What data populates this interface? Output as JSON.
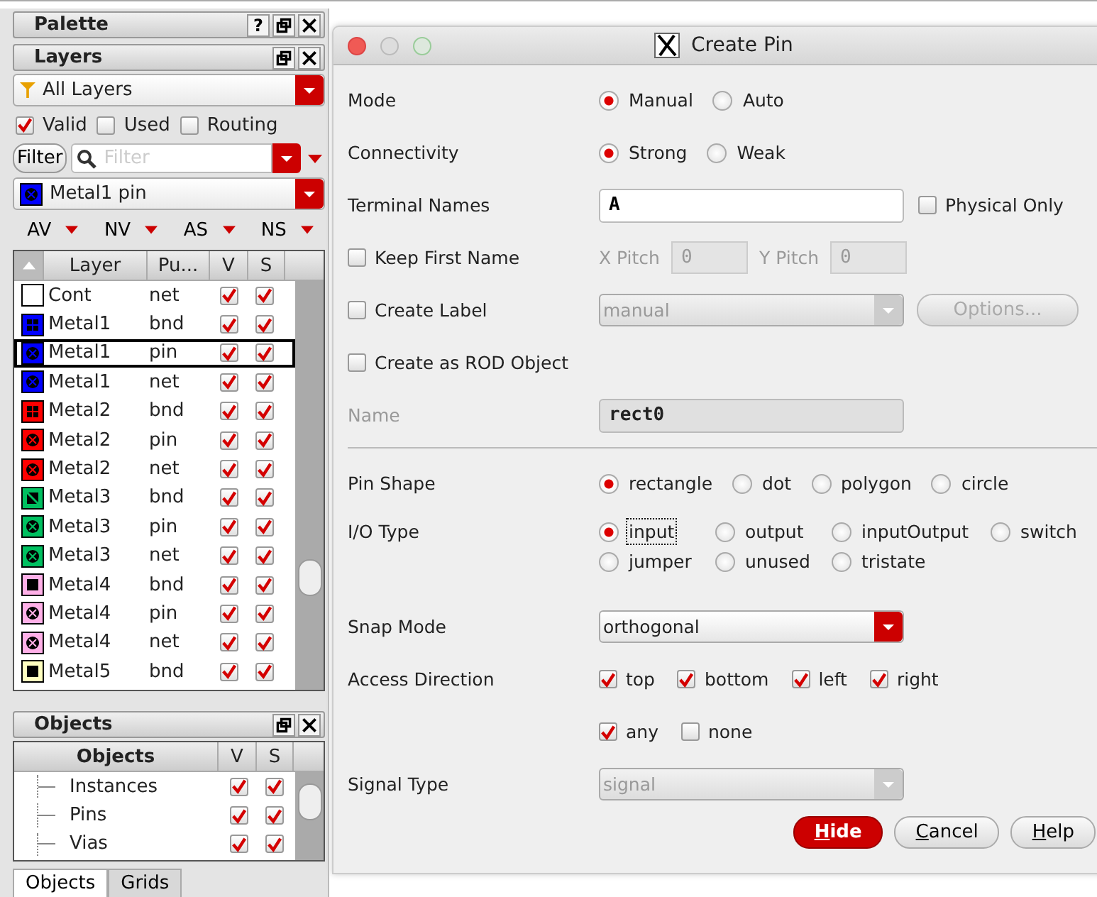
{
  "palette": {
    "title": "Palette",
    "help": "?"
  },
  "layers": {
    "title": "Layers",
    "filter_set": "All Layers",
    "show": [
      {
        "label": "Valid",
        "checked": true
      },
      {
        "label": "Used",
        "checked": false
      },
      {
        "label": "Routing",
        "checked": false
      }
    ],
    "filter_button": "Filter",
    "search": {
      "placeholder": "Filter"
    },
    "current": {
      "label": "Metal1 pin",
      "color": "#0000ff",
      "kind": "cross"
    },
    "menus": [
      "AV",
      "NV",
      "AS",
      "NS"
    ],
    "columns": [
      "Layer",
      "Pu...",
      "V",
      "S"
    ],
    "rows": [
      {
        "name": "Cont",
        "purpose": "net",
        "color": "#ffffff",
        "kind": "none",
        "visible": true,
        "selectable": true,
        "selected": false
      },
      {
        "name": "Metal1",
        "purpose": "bnd",
        "color": "#0000ff",
        "kind": "grid",
        "visible": true,
        "selectable": true,
        "selected": false
      },
      {
        "name": "Metal1",
        "purpose": "pin",
        "color": "#0000ff",
        "kind": "cross",
        "visible": true,
        "selectable": true,
        "selected": true
      },
      {
        "name": "Metal1",
        "purpose": "net",
        "color": "#0000ff",
        "kind": "cross",
        "visible": true,
        "selectable": true,
        "selected": false
      },
      {
        "name": "Metal2",
        "purpose": "bnd",
        "color": "#ff0000",
        "kind": "grid",
        "visible": true,
        "selectable": true,
        "selected": false
      },
      {
        "name": "Metal2",
        "purpose": "pin",
        "color": "#ff0000",
        "kind": "cross",
        "visible": true,
        "selectable": true,
        "selected": false
      },
      {
        "name": "Metal2",
        "purpose": "net",
        "color": "#ff0000",
        "kind": "cross",
        "visible": true,
        "selectable": true,
        "selected": false
      },
      {
        "name": "Metal3",
        "purpose": "bnd",
        "color": "#00c060",
        "kind": "diag",
        "visible": true,
        "selectable": true,
        "selected": false
      },
      {
        "name": "Metal3",
        "purpose": "pin",
        "color": "#00c060",
        "kind": "cross",
        "visible": true,
        "selectable": true,
        "selected": false
      },
      {
        "name": "Metal3",
        "purpose": "net",
        "color": "#00c060",
        "kind": "cross",
        "visible": true,
        "selectable": true,
        "selected": false
      },
      {
        "name": "Metal4",
        "purpose": "bnd",
        "color": "#ffb0e8",
        "kind": "square",
        "visible": true,
        "selectable": true,
        "selected": false
      },
      {
        "name": "Metal4",
        "purpose": "pin",
        "color": "#ffb0e8",
        "kind": "cross",
        "visible": true,
        "selectable": true,
        "selected": false
      },
      {
        "name": "Metal4",
        "purpose": "net",
        "color": "#ffb0e8",
        "kind": "cross",
        "visible": true,
        "selectable": true,
        "selected": false
      },
      {
        "name": "Metal5",
        "purpose": "bnd",
        "color": "#ffffc0",
        "kind": "square",
        "visible": true,
        "selectable": true,
        "selected": false
      }
    ]
  },
  "objects": {
    "title": "Objects",
    "columns": [
      "Objects",
      "V",
      "S"
    ],
    "rows": [
      {
        "name": "Instances",
        "visible": true,
        "selectable": true
      },
      {
        "name": "Pins",
        "visible": true,
        "selectable": true
      },
      {
        "name": "Vias",
        "visible": true,
        "selectable": true
      }
    ]
  },
  "tabs": [
    {
      "label": "Objects",
      "selected": true
    },
    {
      "label": "Grids",
      "selected": false
    }
  ],
  "dialog": {
    "title": "Create Pin",
    "rows": [
      {
        "kind": "radios",
        "label": "Mode",
        "options": [
          {
            "label": "Manual",
            "selected": true
          },
          {
            "label": "Auto",
            "selected": false
          }
        ]
      },
      {
        "kind": "radios",
        "label": "Connectivity",
        "options": [
          {
            "label": "Strong",
            "selected": true
          },
          {
            "label": "Weak",
            "selected": false
          }
        ]
      },
      {
        "kind": "text",
        "label": "Terminal Names",
        "value": "A",
        "disabled": false,
        "side_check": {
          "label": "Physical Only",
          "checked": false
        }
      },
      {
        "kind": "pitch",
        "check": {
          "label": "Keep First Name",
          "checked": false
        },
        "fields": [
          {
            "label": "X Pitch",
            "value": "0"
          },
          {
            "label": "Y Pitch",
            "value": "0"
          }
        ]
      },
      {
        "kind": "combo",
        "check": {
          "label": "Create Label",
          "checked": false
        },
        "value": "manual",
        "disabled": true,
        "button": "Options..."
      },
      {
        "kind": "check",
        "check": {
          "label": "Create as ROD Object",
          "checked": false
        }
      },
      {
        "kind": "text",
        "label": "Name",
        "value": "rect0",
        "disabled": true
      },
      {
        "kind": "separator"
      },
      {
        "kind": "radios",
        "label": "Pin Shape",
        "options": [
          {
            "label": "rectangle",
            "selected": true
          },
          {
            "label": "dot",
            "selected": false
          },
          {
            "label": "polygon",
            "selected": false
          },
          {
            "label": "circle",
            "selected": false
          }
        ]
      },
      {
        "kind": "radios",
        "label": "I/O Type",
        "options": [
          {
            "label": "input",
            "selected": true
          },
          {
            "label": "output",
            "selected": false
          },
          {
            "label": "inputOutput",
            "selected": false
          },
          {
            "label": "switch",
            "selected": false
          },
          {
            "label": "jumper",
            "selected": false
          },
          {
            "label": "unused",
            "selected": false
          },
          {
            "label": "tristate",
            "selected": false
          }
        ]
      },
      {
        "kind": "combo",
        "label": "Snap Mode",
        "value": "orthogonal",
        "disabled": false
      },
      {
        "kind": "checks",
        "label": "Access Direction",
        "options": [
          {
            "label": "top",
            "checked": true
          },
          {
            "label": "bottom",
            "checked": true
          },
          {
            "label": "left",
            "checked": true
          },
          {
            "label": "right",
            "checked": true
          }
        ]
      },
      {
        "kind": "checks",
        "options": [
          {
            "label": "any",
            "checked": true
          },
          {
            "label": "none",
            "checked": false
          }
        ]
      },
      {
        "kind": "combo",
        "label": "Signal Type",
        "value": "signal",
        "disabled": true
      }
    ],
    "buttons": [
      {
        "label": "Hide",
        "default": true
      },
      {
        "label": "Cancel",
        "default": false
      },
      {
        "label": "Help",
        "default": false
      }
    ]
  }
}
